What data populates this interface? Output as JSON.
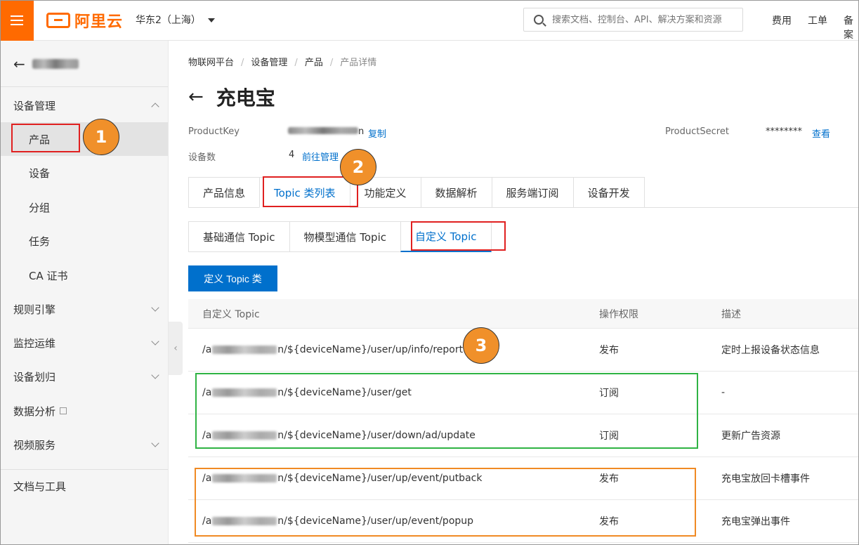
{
  "header": {
    "logo_text": "阿里云",
    "region": "华东2（上海）",
    "search_placeholder": "搜索文档、控制台、API、解决方案和资源",
    "links": [
      "费用",
      "工单",
      "备案"
    ]
  },
  "sidebar": {
    "back_label": "",
    "groups": [
      {
        "label": "设备管理",
        "expanded": true
      },
      {
        "label": "规则引擎"
      },
      {
        "label": "监控运维"
      },
      {
        "label": "设备划归"
      },
      {
        "label": "数据分析"
      },
      {
        "label": "视频服务"
      },
      {
        "label": "文档与工具"
      }
    ],
    "sub_items": [
      "产品",
      "设备",
      "分组",
      "任务",
      "CA 证书"
    ]
  },
  "breadcrumb": [
    "物联网平台",
    "设备管理",
    "产品",
    "产品详情"
  ],
  "page": {
    "title": "充电宝",
    "product_key_label": "ProductKey",
    "product_key_suffix": "n",
    "copy_link": "复制",
    "product_secret_label": "ProductSecret",
    "product_secret_value": "********",
    "view_link": "查看",
    "device_count_label": "设备数",
    "device_count": "4",
    "manage_link": "前往管理"
  },
  "tabs": [
    "产品信息",
    "Topic 类列表",
    "功能定义",
    "数据解析",
    "服务端订阅",
    "设备开发"
  ],
  "subtabs": [
    "基础通信 Topic",
    "物模型通信 Topic",
    "自定义 Topic"
  ],
  "define_button": "定义 Topic 类",
  "table": {
    "headers": [
      "自定义 Topic",
      "操作权限",
      "描述"
    ],
    "rows": [
      {
        "prefix": "/a",
        "path": "n/${deviceName}/user/up/info/report",
        "perm": "发布",
        "desc": "定时上报设备状态信息"
      },
      {
        "prefix": "/a",
        "path": "n/${deviceName}/user/get",
        "perm": "订阅",
        "desc": "-"
      },
      {
        "prefix": "/a",
        "path": "n/${deviceName}/user/down/ad/update",
        "perm": "订阅",
        "desc": "更新广告资源"
      },
      {
        "prefix": "/a",
        "path": "n/${deviceName}/user/up/event/putback",
        "perm": "发布",
        "desc": "充电宝放回卡槽事件"
      },
      {
        "prefix": "/a",
        "path": "n/${deviceName}/user/up/event/popup",
        "perm": "发布",
        "desc": "充电宝弹出事件"
      }
    ]
  },
  "annotations": [
    "1",
    "2",
    "3"
  ],
  "colors": {
    "accent": "#ff6a00",
    "link": "#0070cc",
    "red": "#e02020",
    "green": "#2fb344",
    "orange": "#f08a24"
  }
}
